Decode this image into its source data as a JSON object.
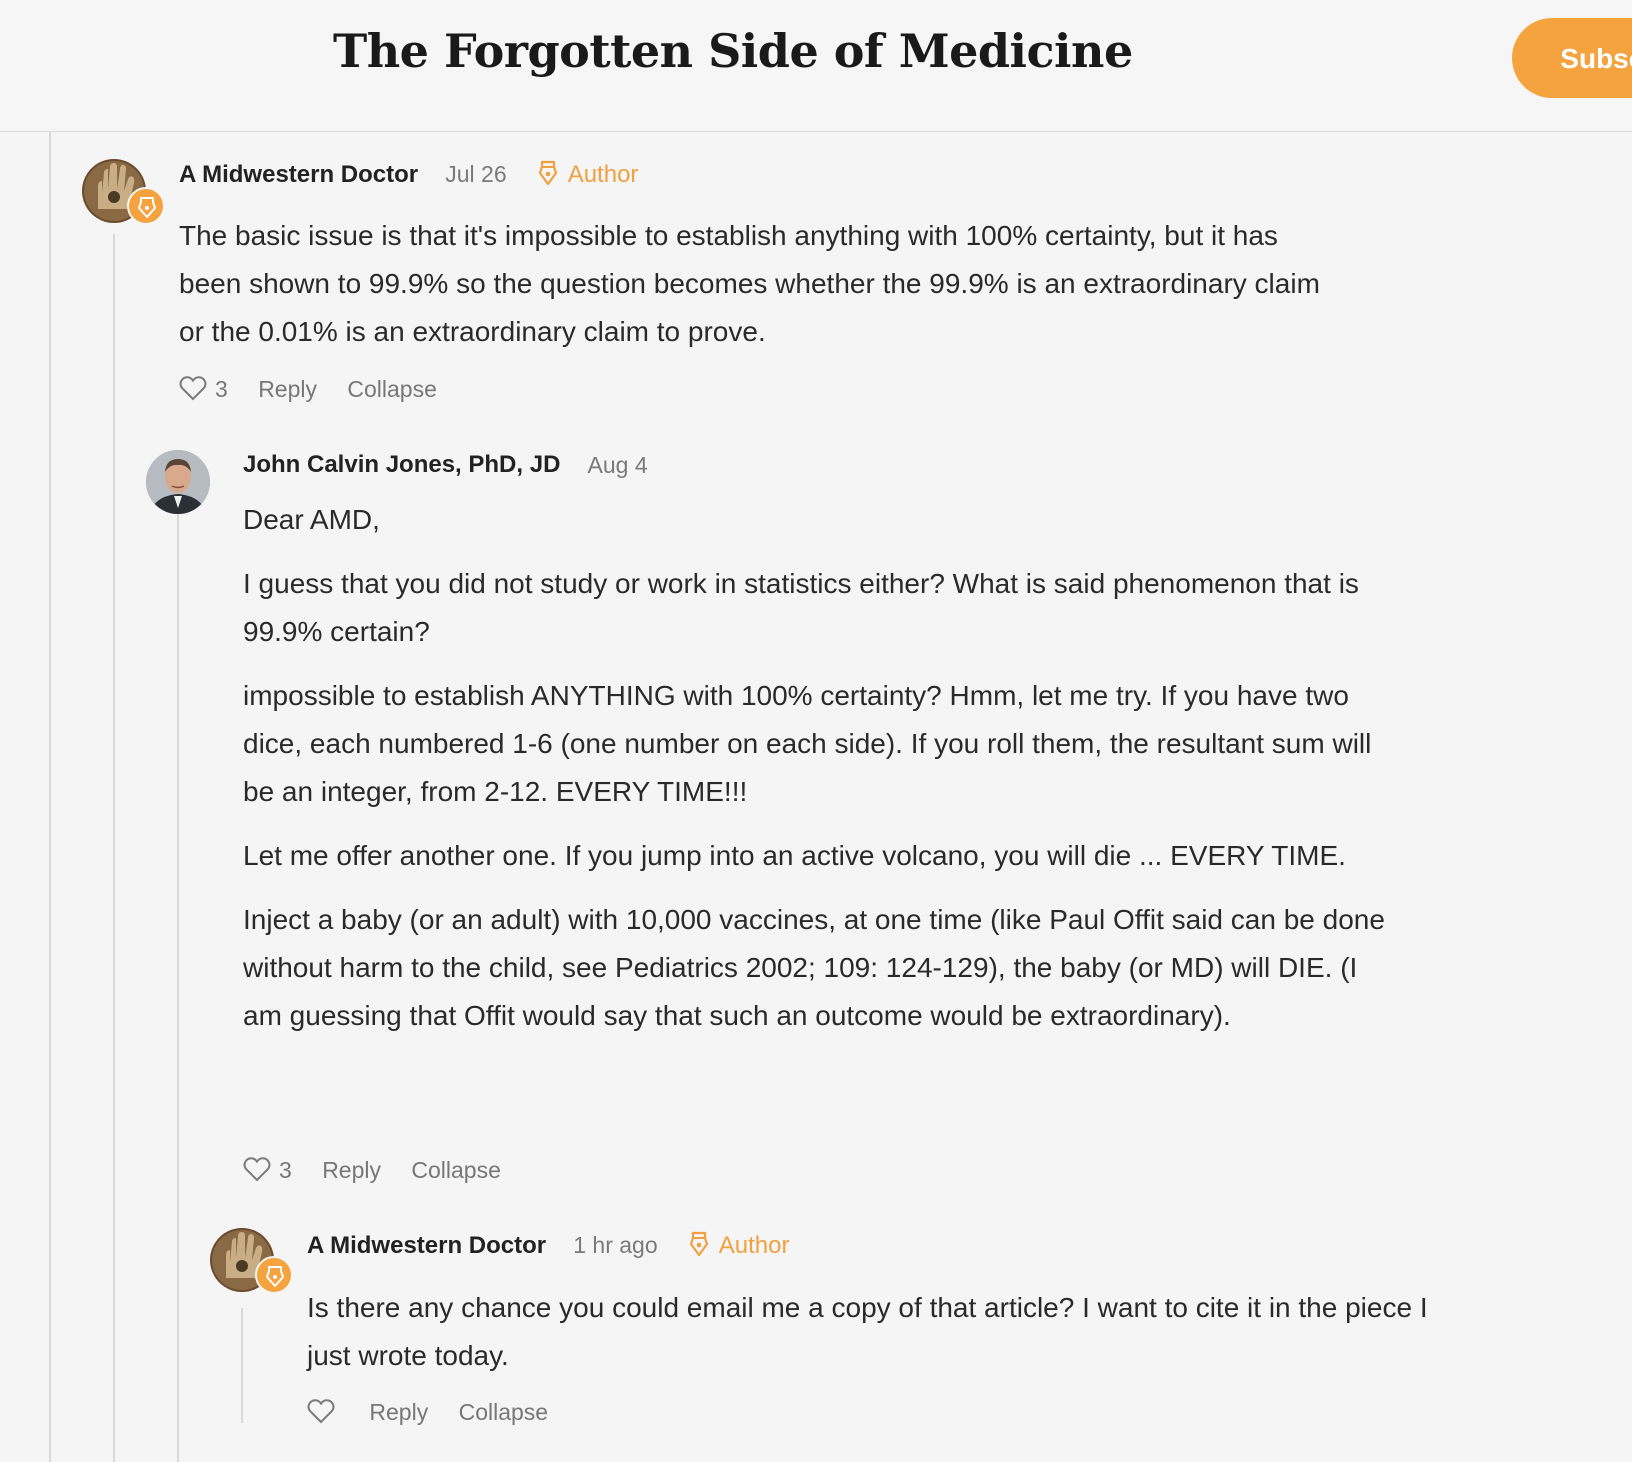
{
  "header": {
    "publication_title": "The Forgotten Side of Medicine",
    "subscribe_label": "Subscribe"
  },
  "comments": [
    {
      "author": "A Midwestern Doctor",
      "date": "Jul 26",
      "badge": "Author",
      "paragraphs": [
        "The basic issue is that it's impossible to establish anything with 100% certainty, but it has been shown to 99.9% so the question becomes whether the 99.9% is an extraordinary claim or the 0.01% is an extraordinary claim to prove."
      ],
      "likes": "3",
      "reply_label": "Reply",
      "collapse_label": "Collapse"
    },
    {
      "author": "John Calvin Jones, PhD, JD",
      "date": "Aug 4",
      "paragraphs": [
        "Dear AMD,",
        "I guess that you did not study or work in statistics either? What is said phenomenon that is 99.9% certain?",
        "impossible to establish ANYTHING with 100% certainty? Hmm, let me try. If you have two dice, each numbered 1-6 (one number on each side). If you roll them, the resultant sum will be an integer, from 2-12. EVERY TIME!!!",
        "Let me offer another one. If you jump into an active volcano, you will die ... EVERY TIME.",
        "Inject a baby (or an adult) with 10,000 vaccines, at one time (like Paul Offit said can be done without harm to the child, see Pediatrics 2002; 109: 124-129), the baby (or MD) will DIE. (I am guessing that Offit would say that such an outcome would be extraordinary)."
      ],
      "likes": "3",
      "reply_label": "Reply",
      "collapse_label": "Collapse"
    },
    {
      "author": "A Midwestern Doctor",
      "date": "1 hr ago",
      "badge": "Author",
      "paragraphs": [
        "Is there any chance you could email me a copy of that article? I want to cite it in the piece I just wrote today."
      ],
      "likes": "",
      "reply_label": "Reply",
      "collapse_label": "Collapse"
    }
  ],
  "colors": {
    "accent": "#f5a33f",
    "background": "#f5f5f5",
    "muted_text": "#777777"
  },
  "icons": {
    "like": "heart-outline-icon",
    "author_badge": "pen-nib-icon"
  }
}
